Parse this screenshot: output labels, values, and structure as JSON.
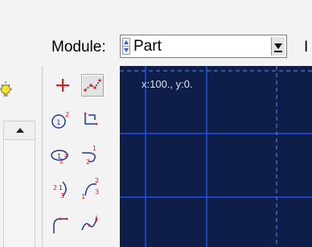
{
  "module_bar": {
    "label": "Module:",
    "selected": "Part",
    "truncated_next_label": "I"
  },
  "toolbox": {
    "tools": [
      {
        "icon": "create-isolated-point-icon"
      },
      {
        "icon": "create-lines-connected-icon"
      },
      {
        "icon": "create-circle-center-perimeter-icon"
      },
      {
        "icon": "create-lines-rectangle-icon"
      },
      {
        "icon": "create-ellipse-icon"
      },
      {
        "icon": "create-arc-tangent-icon"
      },
      {
        "icon": "create-arc-center-endpoints-icon"
      },
      {
        "icon": "create-arc-three-points-icon"
      },
      {
        "icon": "create-fillet-icon"
      },
      {
        "icon": "create-spline-icon"
      }
    ],
    "active_tool": "create-lines-connected-icon"
  },
  "viewport": {
    "coordinate_readout": "x:100., y:0."
  },
  "colors": {
    "viewport_bg": "#0f1e48",
    "grid": "#1e50e6",
    "axis": "#5a8ff0",
    "tool_red": "#e01818",
    "tool_blue": "#1f3a8f"
  }
}
